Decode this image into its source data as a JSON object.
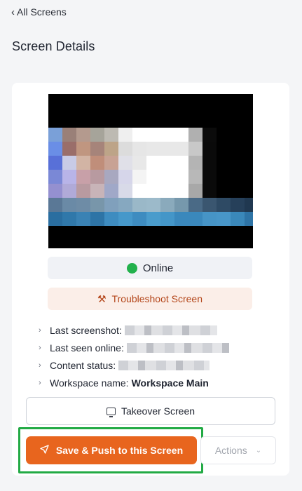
{
  "nav": {
    "back_label": "All Screens",
    "back_icon": "chevron-left-icon"
  },
  "page": {
    "title": "Screen Details"
  },
  "screen": {
    "status_label": "Online",
    "status_color": "#22b14c"
  },
  "troubleshoot": {
    "label": "Troubleshoot Screen",
    "icon": "tools-icon"
  },
  "details": [
    {
      "label": "Last screenshot:",
      "value": "",
      "redacted": true
    },
    {
      "label": "Last seen online:",
      "value": "",
      "redacted": true
    },
    {
      "label": "Content status:",
      "value": "",
      "redacted": true
    },
    {
      "label": "Workspace name:",
      "value": "Workspace Main",
      "redacted": false
    }
  ],
  "actions": {
    "takeover_label": "Takeover Screen",
    "push_label": "Save & Push to this Screen",
    "more_label": "Actions"
  },
  "colors": {
    "accent": "#e8651e",
    "highlight": "#22aa45",
    "troubleshoot_text": "#b4461a"
  },
  "preview_pixels": [
    [
      "#000000",
      "#000000",
      "#000000",
      "#000000",
      "#000000",
      "#000000",
      "#000000",
      "#000000",
      "#000000",
      "#000000",
      "#000000",
      "#000000",
      "#000000",
      "#000000",
      "#000000"
    ],
    [
      "#7aa0d8",
      "#9a8078",
      "#b49a8e",
      "#a6a49a",
      "#bdbab2",
      "#efefef",
      "#ffffff",
      "#ffffff",
      "#ffffff",
      "#ffffff",
      "#b0b0b0",
      "#0b0b0b",
      "#000000",
      "#000000",
      "#000000"
    ],
    [
      "#6a8ee6",
      "#9a6e6a",
      "#c09680",
      "#a6847a",
      "#bda488",
      "#dcdcdc",
      "#e6e6e6",
      "#e8e8e8",
      "#e8e8e8",
      "#e8e8e8",
      "#c8c8c8",
      "#0a0a0a",
      "#000000",
      "#000000",
      "#000000"
    ],
    [
      "#5870d8",
      "#c8cbe6",
      "#d2b4a4",
      "#c08e7a",
      "#c8a294",
      "#e0e0e8",
      "#e8e8e8",
      "#ffffff",
      "#ffffff",
      "#ffffff",
      "#b4b4b4",
      "#0a0a0a",
      "#000000",
      "#000000",
      "#000000"
    ],
    [
      "#7a88d6",
      "#b8b4e8",
      "#c8a0a8",
      "#b89aa0",
      "#a8a8c0",
      "#d6d6ea",
      "#f4f4f4",
      "#ffffff",
      "#ffffff",
      "#ffffff",
      "#b8b8b8",
      "#0a0a0a",
      "#000000",
      "#000000",
      "#000000"
    ],
    [
      "#9490d0",
      "#b0aad8",
      "#b89aa0",
      "#c8b4b8",
      "#a0a8c8",
      "#d8dae8",
      "#ffffff",
      "#ffffff",
      "#ffffff",
      "#ffffff",
      "#a8a8a8",
      "#0a0a0a",
      "#000000",
      "#000000",
      "#000000"
    ],
    [
      "#5a7896",
      "#6a8aa6",
      "#6e8ca6",
      "#7896aa",
      "#80a0bc",
      "#86a8c0",
      "#9ab8c8",
      "#9cbaca",
      "#8aaabc",
      "#7698ac",
      "#4a6a86",
      "#3a5670",
      "#2e4a64",
      "#26405a",
      "#203850"
    ],
    [
      "#2a6ea0",
      "#3078aa",
      "#3a82b4",
      "#2e74a6",
      "#3e8cc0",
      "#4698ca",
      "#3e8cc0",
      "#4a9ccc",
      "#4496c8",
      "#3a88bc",
      "#3a88bc",
      "#4694c6",
      "#4896c8",
      "#3a88ba",
      "#2e74a6"
    ]
  ]
}
